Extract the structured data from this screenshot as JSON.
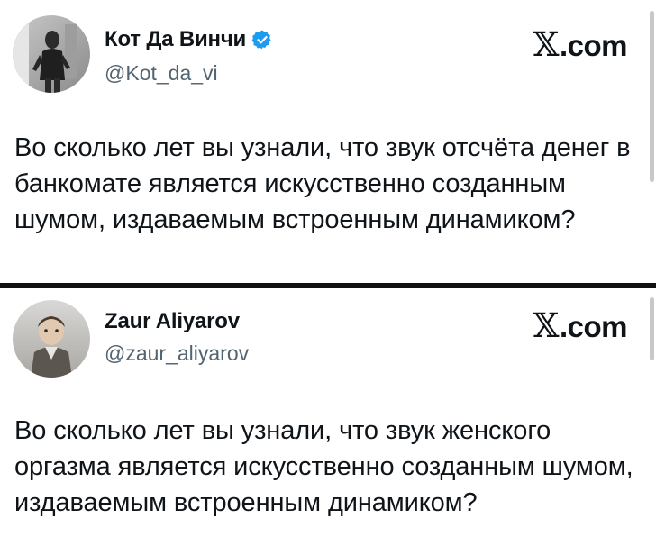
{
  "tweets": [
    {
      "display_name": "Кот Да Винчи",
      "verified": true,
      "handle": "@Kot_da_vi",
      "brand": ".com",
      "brand_glyph": "𝕏",
      "text": "Во сколько лет вы узнали, что звук отсчёта денег в банкомате является искусственно созданным шумом, издаваемым встроенным динамиком?",
      "verified_color": "#1d9bf0"
    },
    {
      "display_name": "Zaur Aliyarov",
      "verified": false,
      "handle": "@zaur_aliyarov",
      "brand": ".com",
      "brand_glyph": "𝕏",
      "text": "Во сколько лет вы узнали, что звук женского оргазма является искусственно созданным шумом, издаваемым встроенным динамиком?"
    }
  ],
  "icons": {
    "verified": "verified-badge-icon",
    "brand": "x-logo-icon"
  }
}
